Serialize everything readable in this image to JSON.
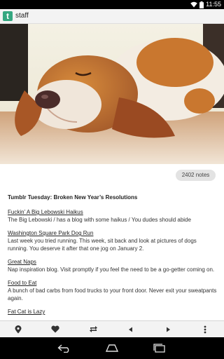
{
  "status_bar": {
    "time": "11:55"
  },
  "app_bar": {
    "logo_letter": "t",
    "blog_name": "staff"
  },
  "post": {
    "image_subject": "basset hound sleeping",
    "notes": "2402 notes",
    "title": "Tumblr Tuesday: Broken New Year’s Resolutions",
    "entries": [
      {
        "link": "Fuckin’ A Big Lebowski Haikus",
        "desc": "The Big Lebowski / has a blog with some haikus / You dudes should abide"
      },
      {
        "link": "Washington Square Park Dog Run",
        "desc": "Last week you tried running. This week, sit back and look at pictures of dogs running. You deserve it after that one jog on January 2."
      },
      {
        "link": "Great Naps",
        "desc": "Nap inspiration blog. Visit promptly if you feel the need to be a go-getter coming on."
      },
      {
        "link": "Food to Eat",
        "desc": "A bunch of bad carbs from food trucks to your front door. Never exit your sweatpants again."
      },
      {
        "link": "Fat Cat is Lazy",
        "desc": ""
      }
    ]
  },
  "action_bar": {
    "icons": [
      "location-pin-icon",
      "heart-icon",
      "reblog-icon",
      "prev-arrow-icon",
      "next-arrow-icon",
      "overflow-menu-icon"
    ]
  },
  "nav_bar": {
    "icons": [
      "back-icon",
      "home-icon",
      "recent-apps-icon"
    ]
  },
  "colors": {
    "brand": "#35a780",
    "status_bar": "#000000",
    "app_bar": "#f3f3f3"
  }
}
